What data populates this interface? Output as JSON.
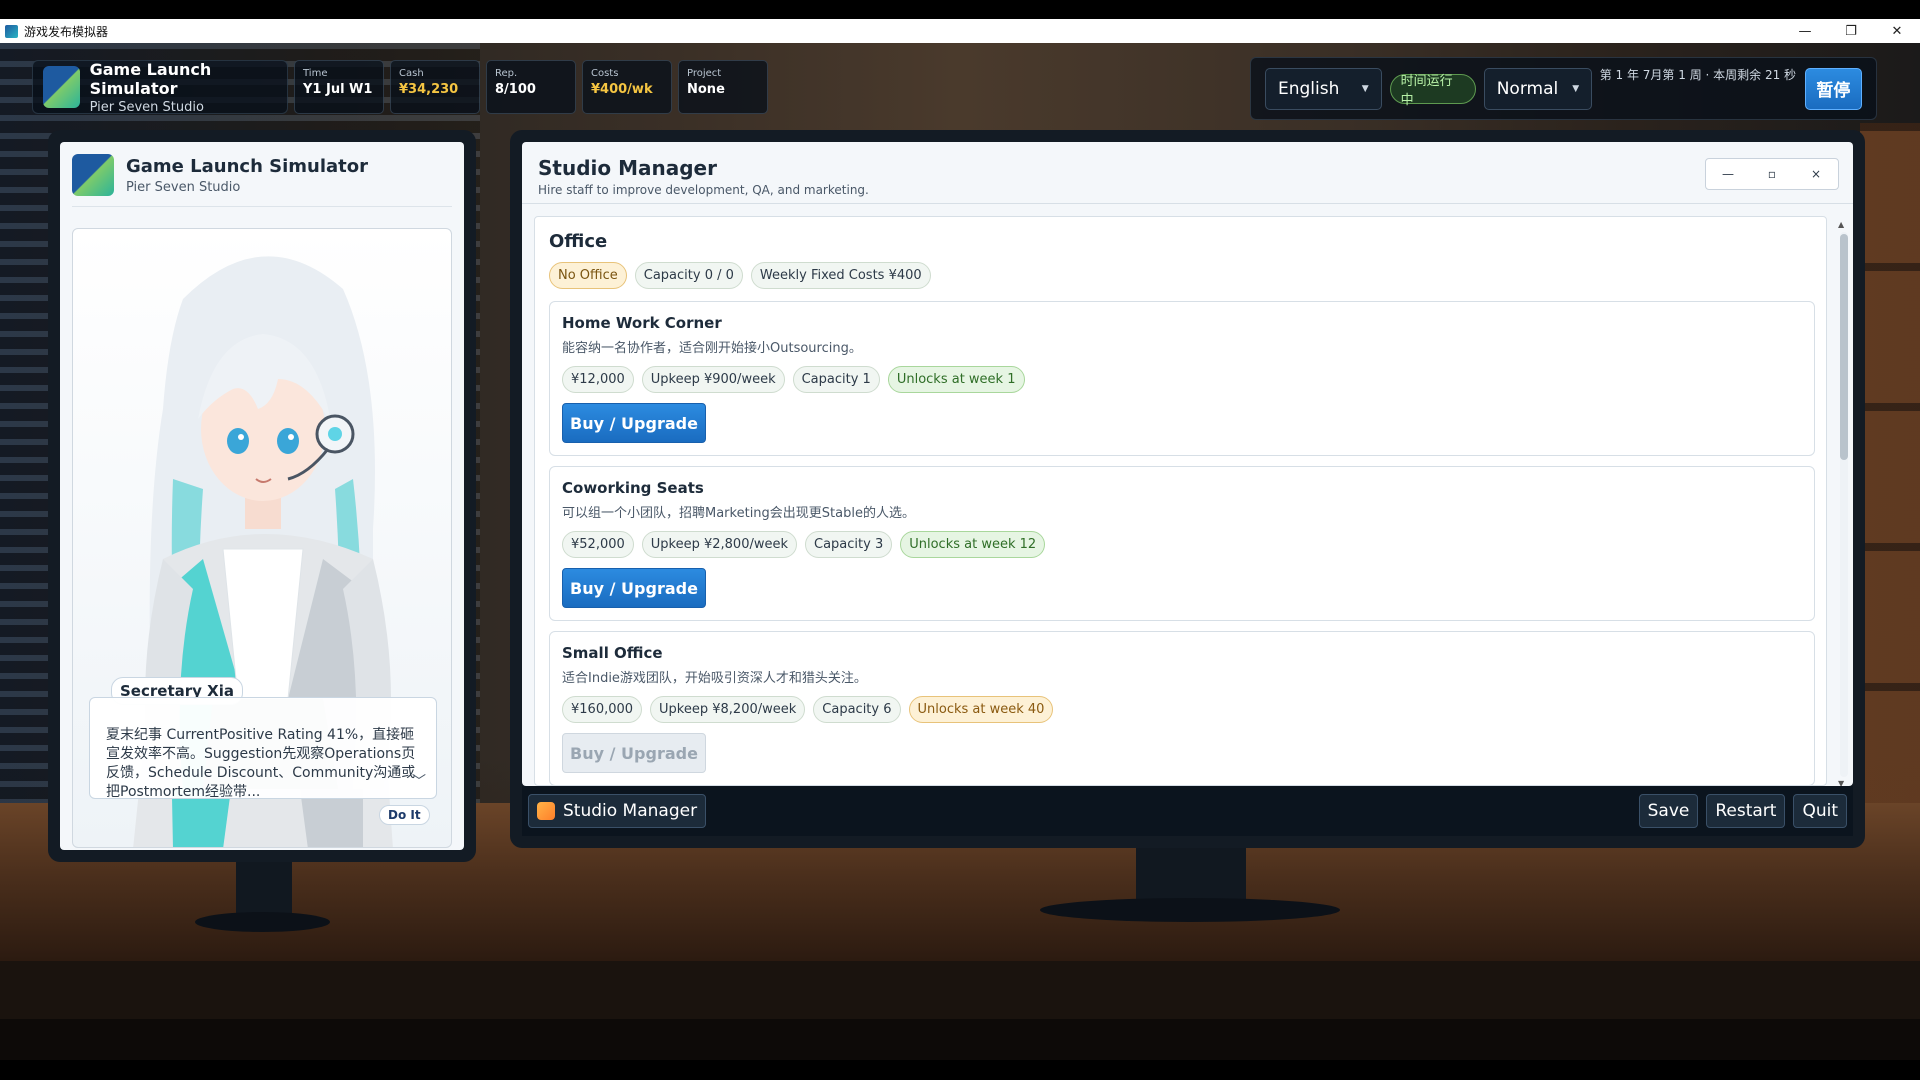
{
  "os_window": {
    "title": "游戏发布模拟器",
    "minimize": "—",
    "restore": "❐",
    "close": "✕"
  },
  "hud": {
    "game_title": "Game Launch Simulator",
    "studio": "Pier Seven Studio",
    "stats": [
      {
        "label": "Time",
        "value": "Y1 Jul W1",
        "accent": false
      },
      {
        "label": "Cash",
        "value": "¥34,230",
        "accent": true
      },
      {
        "label": "Rep.",
        "value": "8/100",
        "accent": false
      },
      {
        "label": "Costs",
        "value": "¥400/wk",
        "accent": true
      },
      {
        "label": "Project",
        "value": "None",
        "accent": false
      }
    ]
  },
  "controls": {
    "language": "English",
    "time_status": "时间运行中",
    "speed": "Normal",
    "week_info": "第 1 年 7月第 1 周 · 本周剩余 21 秒",
    "pause": "暂停"
  },
  "left_panel": {
    "title": "Game Launch Simulator",
    "subtitle": "Pier Seven Studio",
    "secretary_name": "Secretary Xia",
    "dialog": "夏末纪事 CurrentPositive Rating 41%，直接砸宣发效率不高。Suggestion先观察Operations页反馈，Schedule Discount、Community沟通或把Postmortem经验带...",
    "do_it": "Do It"
  },
  "studio_manager": {
    "title": "Studio Manager",
    "subtitle": "Hire staff to improve development, QA, and marketing.",
    "window_controls": {
      "minimize": "—",
      "maximize": "▫",
      "close": "×"
    },
    "office": {
      "heading": "Office",
      "status_tags": [
        "No Office",
        "Capacity 0 / 0",
        "Weekly Fixed Costs ¥400"
      ]
    },
    "offices": [
      {
        "name": "Home Work Corner",
        "desc": "能容纳一名协作者，适合刚开始接小Outsourcing。",
        "price": "¥12,000",
        "upkeep": "Upkeep ¥900/week",
        "capacity": "Capacity 1",
        "unlock": "Unlocks at week 1",
        "unlock_state": "green",
        "button": "Buy / Upgrade",
        "enabled": true
      },
      {
        "name": "Coworking Seats",
        "desc": "可以组一个小团队，招聘Marketing会出现更Stable的人选。",
        "price": "¥52,000",
        "upkeep": "Upkeep ¥2,800/week",
        "capacity": "Capacity 3",
        "unlock": "Unlocks at week 12",
        "unlock_state": "green",
        "button": "Buy / Upgrade",
        "enabled": true
      },
      {
        "name": "Small Office",
        "desc": "适合Indie游戏团队，开始吸引资深人才和猎头关注。",
        "price": "¥160,000",
        "upkeep": "Upkeep ¥8,200/week",
        "capacity": "Capacity 6",
        "unlock": "Unlocks at week 40",
        "unlock_state": "orange",
        "button": "Buy / Upgrade",
        "enabled": false
      }
    ]
  },
  "taskbar": {
    "active_item": "Studio Manager",
    "save": "Save",
    "restart": "Restart",
    "quit": "Quit"
  }
}
